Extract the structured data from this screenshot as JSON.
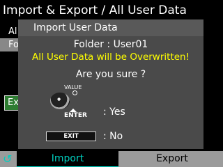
{
  "screen": {
    "title": "Import & Export / All User Data",
    "background": {
      "row_all": "Al",
      "row_folder": "Fo",
      "exec_button": "Ex"
    }
  },
  "dialog": {
    "title": "Import User Data",
    "folder_line": "Folder : User01",
    "warning": "All User Data will be Overwritten!",
    "question": "Are you sure ?",
    "value_label": "VALUE",
    "enter_label": "ENTER",
    "yes_label": ": Yes",
    "exit_label": "EXIT",
    "no_label": ": No"
  },
  "bottom_bar": {
    "back_icon": "↺",
    "tabs": [
      {
        "label": "Import",
        "selected": true
      },
      {
        "label": "Export",
        "selected": false
      }
    ]
  },
  "colors": {
    "accent": "#00d0c0",
    "warning": "#ffff00",
    "dialog_bg": "#4a4a4a",
    "bar_bg": "#9b9b9b"
  }
}
